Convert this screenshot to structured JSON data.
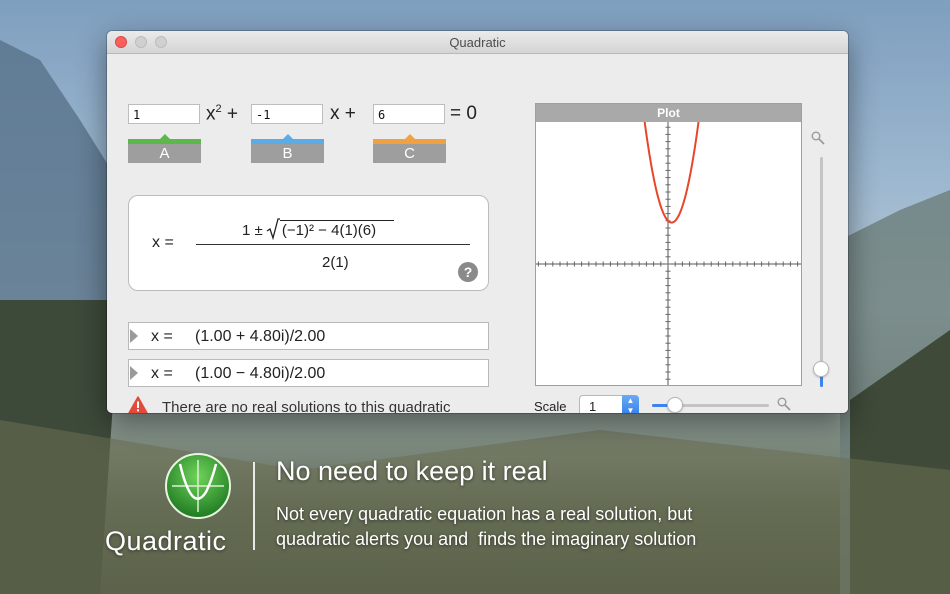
{
  "window": {
    "title": "Quadratic"
  },
  "equation": {
    "a_value": "1",
    "b_value": "-1",
    "c_value": "6",
    "x_squared": "x",
    "exponent": "2",
    "plus1": "+",
    "x_term": "x",
    "plus2": "+",
    "equals_zero": "= 0",
    "tab_a": "A",
    "tab_b": "B",
    "tab_c": "C",
    "tab_colors": {
      "a": "#5cb84a",
      "b": "#5aabe6",
      "c": "#f0a142"
    }
  },
  "formula": {
    "lhs": "x =",
    "numerator_prefix": "1 ±",
    "radicand": "(−1)² − 4(1)(6)",
    "denominator": "2(1)",
    "help_icon": "?"
  },
  "solutions": [
    {
      "lhs": "x =",
      "value": "(1.00 + 4.80i)/2.00"
    },
    {
      "lhs": "x =",
      "value": "(1.00 − 4.80i)/2.00"
    }
  ],
  "warning": {
    "icon": "warning-triangle-icon",
    "text": "There are no real solutions to this quadratic"
  },
  "plot": {
    "header": "Plot",
    "curve_color": "#e8452a",
    "scale_label": "Scale",
    "scale_value": "1",
    "h_zoom_level": 0.2,
    "v_zoom_level": 0.08
  },
  "chart_data": {
    "type": "line",
    "function": "y = x^2 - x + 6",
    "a": 1,
    "b": -1,
    "c": 6,
    "grid": false
  },
  "promo": {
    "app_name": "Quadratic",
    "headline": "No need to keep it real",
    "line1": "Not every quadratic equation has a real solution, but",
    "line2": "quadratic alerts you and  finds the imaginary solution"
  }
}
